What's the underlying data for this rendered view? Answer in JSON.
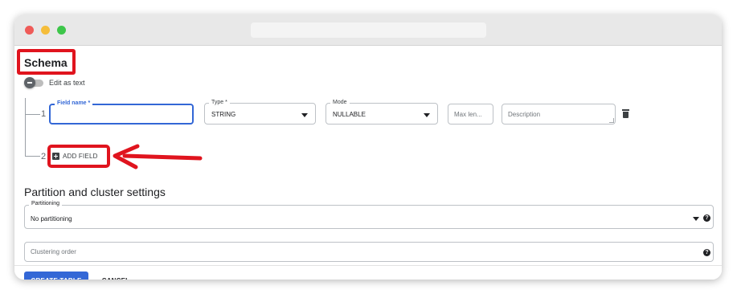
{
  "schema": {
    "title": "Schema",
    "edit_as_text_label": "Edit as text",
    "rows": [
      {
        "number": "1",
        "field_name": {
          "label": "Field name *",
          "value": ""
        },
        "type": {
          "label": "Type *",
          "value": "STRING"
        },
        "mode": {
          "label": "Mode",
          "value": "NULLABLE"
        },
        "max_length": {
          "placeholder": "Max len..."
        },
        "description": {
          "placeholder": "Description"
        }
      }
    ],
    "next_row_number": "2",
    "add_field_label": "ADD FIELD"
  },
  "partition": {
    "title": "Partition and cluster settings",
    "partitioning": {
      "label": "Partitioning",
      "value": "No partitioning"
    },
    "clustering": {
      "placeholder": "Clustering order"
    }
  },
  "footer": {
    "create_label": "CREATE TABLE",
    "cancel_label": "CANCEL"
  },
  "icons": {
    "trash": "trash-icon",
    "help": "help-icon",
    "plus": "plus-box-icon",
    "dropdown": "caret-down-icon"
  },
  "colors": {
    "accent": "#3367d6",
    "annotation_red": "#e0141e"
  }
}
